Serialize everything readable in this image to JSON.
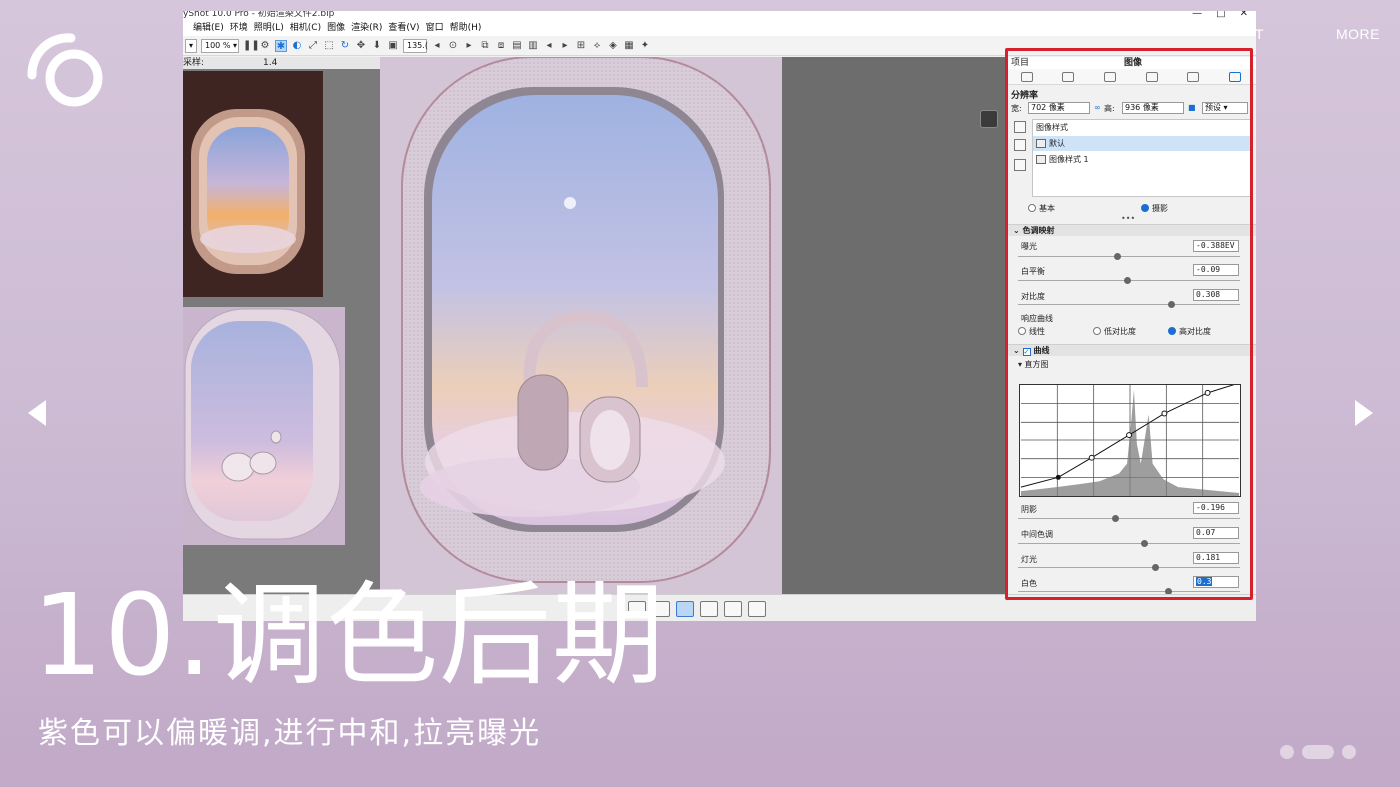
{
  "slide": {
    "more_label": "MORE",
    "partial_nav": "T",
    "title": "10.调色后期",
    "subtitle": "紫色可以偏暖调,进行中和,拉亮曝光"
  },
  "window": {
    "title": "yShot 10.0 Pro - 初始渲染文件2.bip",
    "controls": [
      "—",
      "□",
      "✕"
    ]
  },
  "menu": [
    "编辑(E)",
    "环境",
    "照明(L)",
    "相机(C)",
    "图像",
    "渲染(R)",
    "查看(V)",
    "窗口",
    "帮助(H)"
  ],
  "toolbar": {
    "mode_select": "▾",
    "zoom": "100 % ▾",
    "number": "135.("
  },
  "library": {
    "label": "采样:",
    "value": "1.4"
  },
  "panel": {
    "tab_left": "项目",
    "tab_center": "图像",
    "resolution": {
      "title": "分辨率",
      "width_label": "宽:",
      "width_value": "702 像素",
      "height_label": "高:",
      "height_value": "936 像素",
      "preset": "预设 ▾"
    },
    "image_styles": {
      "header": "图像样式",
      "items": [
        "默认",
        "图像样式 1"
      ]
    },
    "mode": {
      "basic": "基本",
      "photo": "摄影"
    },
    "tone_mapping": {
      "title": "色调映射",
      "exposure_label": "曝光",
      "exposure_value": "-0.388EV",
      "white_balance_label": "白平衡",
      "white_balance_value": "-0.09",
      "contrast_label": "对比度",
      "contrast_value": "0.308",
      "response_label": "响应曲线",
      "response_options": [
        "线性",
        "低对比度",
        "高对比度"
      ]
    },
    "curves": {
      "title": "曲线",
      "histogram_label": "▾ 直方图",
      "shadows_label": "阴影",
      "shadows_value": "-0.196",
      "midtones_label": "中间色调",
      "midtones_value": "0.07",
      "highlights_label": "灯光",
      "highlights_value": "0.181",
      "whites_label": "白色",
      "whites_value": "0.3"
    }
  },
  "colors": {
    "accent": "#1a6fd1",
    "highlight_frame": "#d6202b",
    "background": "#cdbcd4"
  }
}
